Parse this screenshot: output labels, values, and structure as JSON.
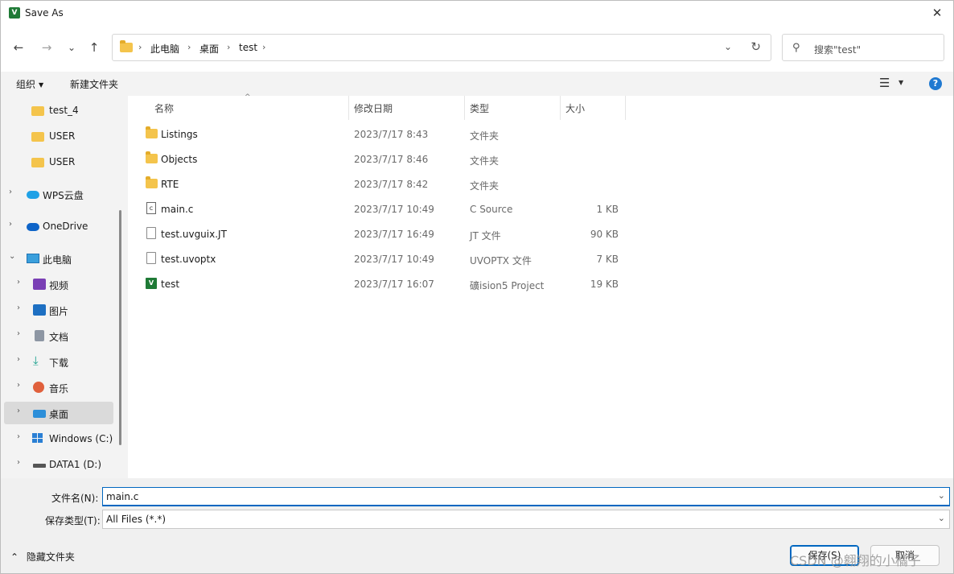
{
  "window": {
    "title": "Save As",
    "app_icon": "keil-uvision-icon"
  },
  "nav": {
    "back": "←",
    "forward": "→",
    "recent": "⌄",
    "up": "↑"
  },
  "address": {
    "crumbs": [
      "此电脑",
      "桌面",
      "test"
    ],
    "sep": "›"
  },
  "search": {
    "placeholder": "搜索\"test\""
  },
  "toolbar": {
    "organize": "组织",
    "new_folder": "新建文件夹"
  },
  "sidebar": {
    "items": [
      {
        "label": "test_4",
        "icon": "folder-icon"
      },
      {
        "label": "USER",
        "icon": "folder-icon"
      },
      {
        "label": "USER",
        "icon": "folder-icon"
      },
      {
        "label": "WPS云盘",
        "icon": "wps-cloud-icon"
      },
      {
        "label": "OneDrive",
        "icon": "onedrive-icon"
      },
      {
        "label": "此电脑",
        "icon": "this-pc-icon"
      },
      {
        "label": "视频",
        "icon": "videos-icon"
      },
      {
        "label": "图片",
        "icon": "pictures-icon"
      },
      {
        "label": "文档",
        "icon": "documents-icon"
      },
      {
        "label": "下载",
        "icon": "downloads-icon"
      },
      {
        "label": "音乐",
        "icon": "music-icon"
      },
      {
        "label": "桌面",
        "icon": "desktop-icon"
      },
      {
        "label": "Windows (C:)",
        "icon": "windows-drive-icon"
      },
      {
        "label": "DATA1 (D:)",
        "icon": "drive-icon"
      }
    ]
  },
  "columns": {
    "name": "名称",
    "date": "修改日期",
    "type": "类型",
    "size": "大小"
  },
  "files": [
    {
      "name": "Listings",
      "date": "2023/7/17 8:43",
      "type": "文件夹",
      "size": "",
      "icon": "folder-icon"
    },
    {
      "name": "Objects",
      "date": "2023/7/17 8:46",
      "type": "文件夹",
      "size": "",
      "icon": "folder-icon"
    },
    {
      "name": "RTE",
      "date": "2023/7/17 8:42",
      "type": "文件夹",
      "size": "",
      "icon": "folder-icon"
    },
    {
      "name": "main.c",
      "date": "2023/7/17 10:49",
      "type": "C Source",
      "size": "1 KB",
      "icon": "c-source-file-icon"
    },
    {
      "name": "test.uvguix.JT",
      "date": "2023/7/17 16:49",
      "type": "JT 文件",
      "size": "90 KB",
      "icon": "file-icon"
    },
    {
      "name": "test.uvoptx",
      "date": "2023/7/17 10:49",
      "type": "UVOPTX 文件",
      "size": "7 KB",
      "icon": "file-icon"
    },
    {
      "name": "test",
      "date": "2023/7/17 16:07",
      "type": "礦ision5 Project",
      "size": "19 KB",
      "icon": "uvision-project-icon"
    }
  ],
  "form": {
    "filename_label": "文件名(N):",
    "filename_value": "main.c",
    "filetype_label": "保存类型(T):",
    "filetype_value": "All Files (*.*)"
  },
  "footer": {
    "hide_folders": "隐藏文件夹",
    "save": "保存(S)",
    "cancel": "取消",
    "watermark": "CSDN @翱翔的小橘子"
  },
  "colors": {
    "accent": "#0067c0",
    "folder": "#f4c44c",
    "help": "#1f79d1"
  }
}
